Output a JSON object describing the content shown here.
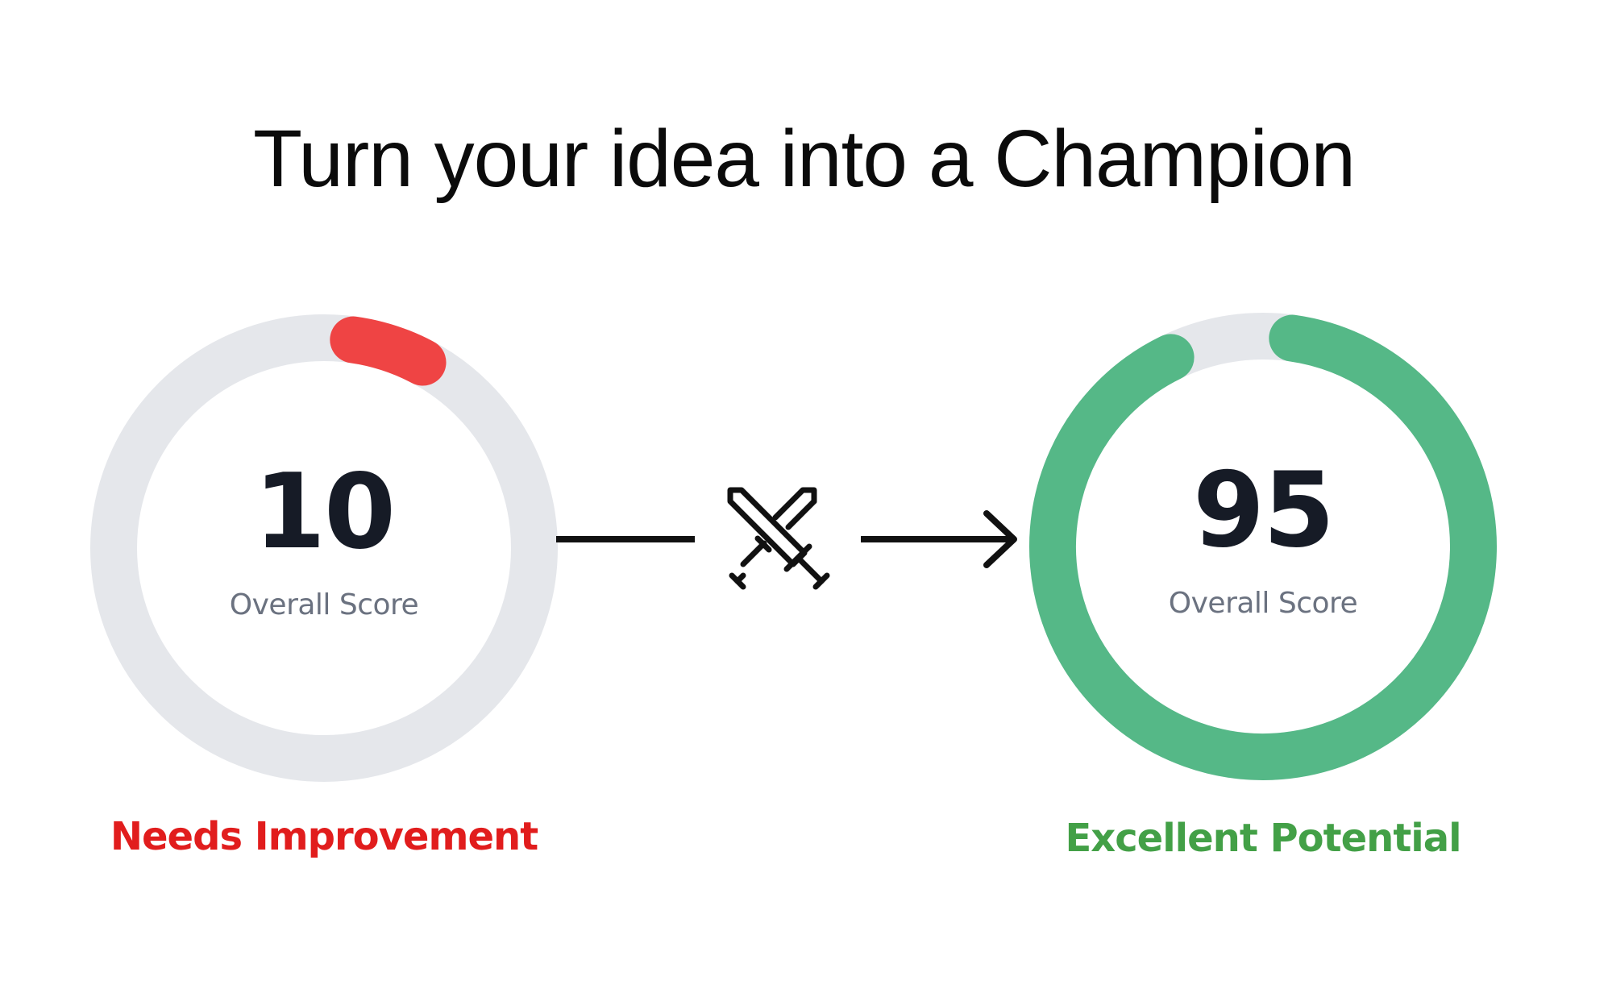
{
  "headline": "Turn your idea into a Champion",
  "before": {
    "score": "10",
    "score_value": 10,
    "caption": "Overall Score",
    "verdict": "Needs Improvement",
    "arc_color": "#ef4444",
    "track_color": "#e5e7eb",
    "verdict_color": "#e11d1d"
  },
  "after": {
    "score": "95",
    "score_value": 95,
    "caption": "Overall Score",
    "verdict": "Excellent Potential",
    "arc_color": "#55b887",
    "track_color": "#e5e7eb",
    "verdict_color": "#43a047"
  },
  "connector": {
    "icon": "crossed-swords-icon",
    "color": "#111111"
  }
}
